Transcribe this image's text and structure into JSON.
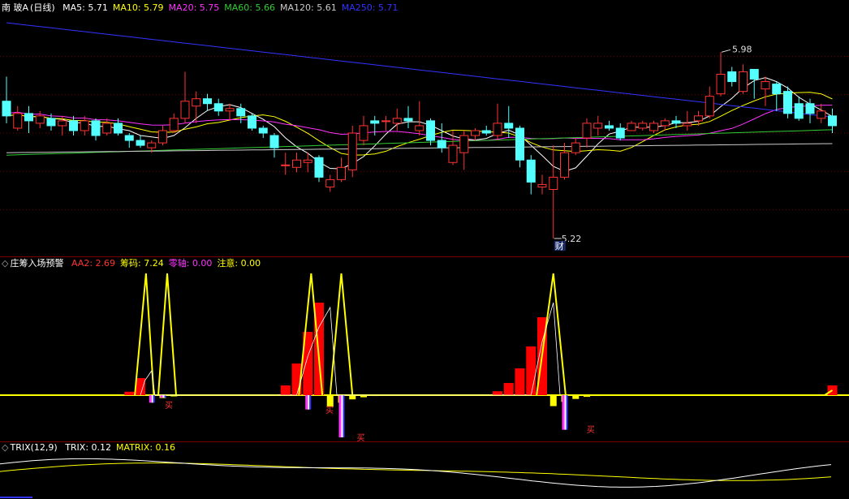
{
  "main_panel": {
    "stock_name": "南 玻A",
    "period": "(日线)",
    "ma_indicators": [
      {
        "name": "MA5",
        "value": "5.71",
        "color": "#ffffff"
      },
      {
        "name": "MA10",
        "value": "5.79",
        "color": "#ffff00"
      },
      {
        "name": "MA20",
        "value": "5.75",
        "color": "#ff33ff"
      },
      {
        "name": "MA60",
        "value": "5.66",
        "color": "#33cc33"
      },
      {
        "name": "MA120",
        "value": "5.61",
        "color": "#cccccc"
      },
      {
        "name": "MA250",
        "value": "5.71",
        "color": "#3333ff"
      }
    ],
    "high_label": "5.98",
    "low_label": "5.22",
    "event_tag": "财"
  },
  "indicator_panel": {
    "name": "庄筹入场预警",
    "values": [
      {
        "name": "AA2",
        "value": "2.69",
        "color": "#ff3333"
      },
      {
        "name": "筹码",
        "value": "7.24",
        "color": "#ffff00"
      },
      {
        "name": "零轴",
        "value": "0.00",
        "color": "#ff33ff"
      },
      {
        "name": "注意",
        "value": "0.00",
        "color": "#ffff00"
      }
    ],
    "buy_label": "买"
  },
  "trix_panel": {
    "name": "TRIX(12,9)",
    "values": [
      {
        "name": "TRIX",
        "value": "0.12",
        "color": "#ffffff"
      },
      {
        "name": "MATRIX",
        "value": "0.16",
        "color": "#ffff00"
      }
    ]
  },
  "colors": {
    "up": "#ff3333",
    "down": "#54ffff",
    "background": "#000000",
    "grid": "#7a0000"
  },
  "chart_data": [
    {
      "type": "candlestick",
      "title": "南 玻A (日线)",
      "ylim": [
        5.18,
        6.12
      ],
      "candles": [
        [
          5.78,
          5.72,
          5.88,
          5.69
        ],
        [
          5.67,
          5.73,
          5.76,
          5.66
        ],
        [
          5.73,
          5.7,
          5.76,
          5.65
        ],
        [
          5.69,
          5.72,
          5.74,
          5.67
        ],
        [
          5.71,
          5.68,
          5.73,
          5.66
        ],
        [
          5.68,
          5.7,
          5.72,
          5.64
        ],
        [
          5.7,
          5.66,
          5.72,
          5.64
        ],
        [
          5.66,
          5.7,
          5.72,
          5.64
        ],
        [
          5.7,
          5.64,
          5.71,
          5.62
        ],
        [
          5.65,
          5.69,
          5.71,
          5.64
        ],
        [
          5.69,
          5.65,
          5.71,
          5.64
        ],
        [
          5.64,
          5.62,
          5.65,
          5.59
        ],
        [
          5.62,
          5.6,
          5.64,
          5.59
        ],
        [
          5.59,
          5.61,
          5.62,
          5.57
        ],
        [
          5.61,
          5.66,
          5.68,
          5.6
        ],
        [
          5.66,
          5.71,
          5.73,
          5.65
        ],
        [
          5.71,
          5.78,
          5.9,
          5.69
        ],
        [
          5.76,
          5.79,
          5.82,
          5.69
        ],
        [
          5.79,
          5.77,
          5.81,
          5.74
        ],
        [
          5.77,
          5.74,
          5.79,
          5.72
        ],
        [
          5.74,
          5.75,
          5.77,
          5.7
        ],
        [
          5.75,
          5.72,
          5.77,
          5.69
        ],
        [
          5.72,
          5.67,
          5.73,
          5.66
        ],
        [
          5.67,
          5.65,
          5.68,
          5.63
        ],
        [
          5.64,
          5.59,
          5.65,
          5.55
        ],
        [
          5.52,
          5.52,
          5.57,
          5.48
        ],
        [
          5.51,
          5.54,
          5.57,
          5.49
        ],
        [
          5.53,
          5.54,
          5.57,
          5.49
        ],
        [
          5.55,
          5.47,
          5.56,
          5.45
        ],
        [
          5.43,
          5.46,
          5.48,
          5.41
        ],
        [
          5.46,
          5.51,
          5.55,
          5.45
        ],
        [
          5.5,
          5.65,
          5.68,
          5.47
        ],
        [
          5.62,
          5.68,
          5.72,
          5.6
        ],
        [
          5.7,
          5.69,
          5.72,
          5.64
        ],
        [
          5.7,
          5.7,
          5.72,
          5.66
        ],
        [
          5.69,
          5.71,
          5.75,
          5.66
        ],
        [
          5.71,
          5.7,
          5.76,
          5.67
        ],
        [
          5.66,
          5.68,
          5.78,
          5.64
        ],
        [
          5.7,
          5.62,
          5.71,
          5.6
        ],
        [
          5.62,
          5.59,
          5.69,
          5.57
        ],
        [
          5.53,
          5.6,
          5.66,
          5.52
        ],
        [
          5.57,
          5.64,
          5.66,
          5.5
        ],
        [
          5.64,
          5.66,
          5.67,
          5.62
        ],
        [
          5.66,
          5.65,
          5.68,
          5.64
        ],
        [
          5.64,
          5.69,
          5.77,
          5.62
        ],
        [
          5.69,
          5.67,
          5.76,
          5.63
        ],
        [
          5.67,
          5.54,
          5.68,
          5.51
        ],
        [
          5.54,
          5.45,
          5.56,
          5.4
        ],
        [
          5.43,
          5.44,
          5.48,
          5.4
        ],
        [
          5.42,
          5.47,
          5.6,
          5.22
        ],
        [
          5.47,
          5.57,
          5.61,
          5.46
        ],
        [
          5.57,
          5.61,
          5.63,
          5.56
        ],
        [
          5.63,
          5.69,
          5.71,
          5.59
        ],
        [
          5.67,
          5.69,
          5.72,
          5.64
        ],
        [
          5.68,
          5.67,
          5.7,
          5.66
        ],
        [
          5.67,
          5.63,
          5.69,
          5.62
        ],
        [
          5.66,
          5.69,
          5.7,
          5.66
        ],
        [
          5.67,
          5.69,
          5.7,
          5.66
        ],
        [
          5.66,
          5.69,
          5.7,
          5.65
        ],
        [
          5.68,
          5.7,
          5.71,
          5.66
        ],
        [
          5.7,
          5.69,
          5.72,
          5.67
        ],
        [
          5.68,
          5.69,
          5.74,
          5.66
        ],
        [
          5.7,
          5.72,
          5.74,
          5.68
        ],
        [
          5.72,
          5.8,
          5.84,
          5.71
        ],
        [
          5.81,
          5.89,
          5.98,
          5.8
        ],
        [
          5.9,
          5.86,
          5.92,
          5.84
        ],
        [
          5.82,
          5.9,
          5.93,
          5.81
        ],
        [
          5.91,
          5.87,
          5.91,
          5.79
        ],
        [
          5.83,
          5.86,
          5.88,
          5.76
        ],
        [
          5.85,
          5.81,
          5.86,
          5.74
        ],
        [
          5.82,
          5.73,
          5.84,
          5.71
        ],
        [
          5.77,
          5.71,
          5.8,
          5.7
        ],
        [
          5.77,
          5.73,
          5.79,
          5.69
        ],
        [
          5.71,
          5.74,
          5.77,
          5.69
        ],
        [
          5.72,
          5.68,
          5.75,
          5.65
        ]
      ],
      "series": [
        {
          "name": "MA5",
          "value": 5.71,
          "color": "#ffffff"
        },
        {
          "name": "MA10",
          "value": 5.79,
          "color": "#ffff00"
        },
        {
          "name": "MA20",
          "value": 5.75,
          "color": "#ff33ff"
        },
        {
          "name": "MA60",
          "value": 5.66,
          "color": "#33cc33"
        },
        {
          "name": "MA120",
          "value": 5.61,
          "color": "#cccccc"
        },
        {
          "name": "MA250",
          "value": 5.71,
          "color": "#3333ff"
        }
      ],
      "annotations": [
        {
          "text": "5.98",
          "index": 64
        },
        {
          "text": "5.22",
          "index": 49
        },
        {
          "text": "财",
          "index": 49
        }
      ]
    },
    {
      "type": "bar",
      "title": "庄筹入场预警",
      "ylim": [
        -1.0,
        2.6
      ],
      "red_bars": [
        [
          11,
          0.07
        ],
        [
          12,
          0.35
        ],
        [
          25,
          0.2
        ],
        [
          26,
          0.65
        ],
        [
          27,
          1.3
        ],
        [
          28,
          1.9
        ],
        [
          44,
          0.08
        ],
        [
          45,
          0.25
        ],
        [
          46,
          0.55
        ],
        [
          47,
          1.0
        ],
        [
          48,
          1.6
        ],
        [
          74,
          0.2
        ]
      ],
      "yellow_bars": [
        [
          14,
          -0.07
        ],
        [
          15,
          -0.03
        ],
        [
          29,
          -0.28
        ],
        [
          30,
          -0.18
        ],
        [
          31,
          -0.1
        ],
        [
          32,
          -0.05
        ],
        [
          33,
          -0.02
        ],
        [
          49,
          -0.26
        ],
        [
          50,
          -0.16
        ],
        [
          51,
          -0.09
        ],
        [
          52,
          -0.04
        ],
        [
          53,
          -0.02
        ]
      ],
      "magenta_bars": [
        [
          13,
          -0.18
        ],
        [
          14,
          -0.06
        ],
        [
          27,
          -0.34
        ],
        [
          30,
          -1.0
        ],
        [
          50,
          -0.82
        ]
      ],
      "yellow_line_peaks": [
        [
          12,
          2.5
        ],
        [
          14,
          2.5
        ],
        [
          27,
          2.5
        ],
        [
          30,
          2.5
        ],
        [
          49,
          2.5
        ]
      ],
      "buy_signals": [
        13,
        27,
        31,
        51
      ]
    },
    {
      "type": "line",
      "title": "TRIX(12,9)",
      "series": [
        {
          "name": "TRIX",
          "value": 0.12,
          "color": "#ffffff"
        },
        {
          "name": "MATRIX",
          "value": 0.16,
          "color": "#ffff00"
        }
      ]
    }
  ]
}
